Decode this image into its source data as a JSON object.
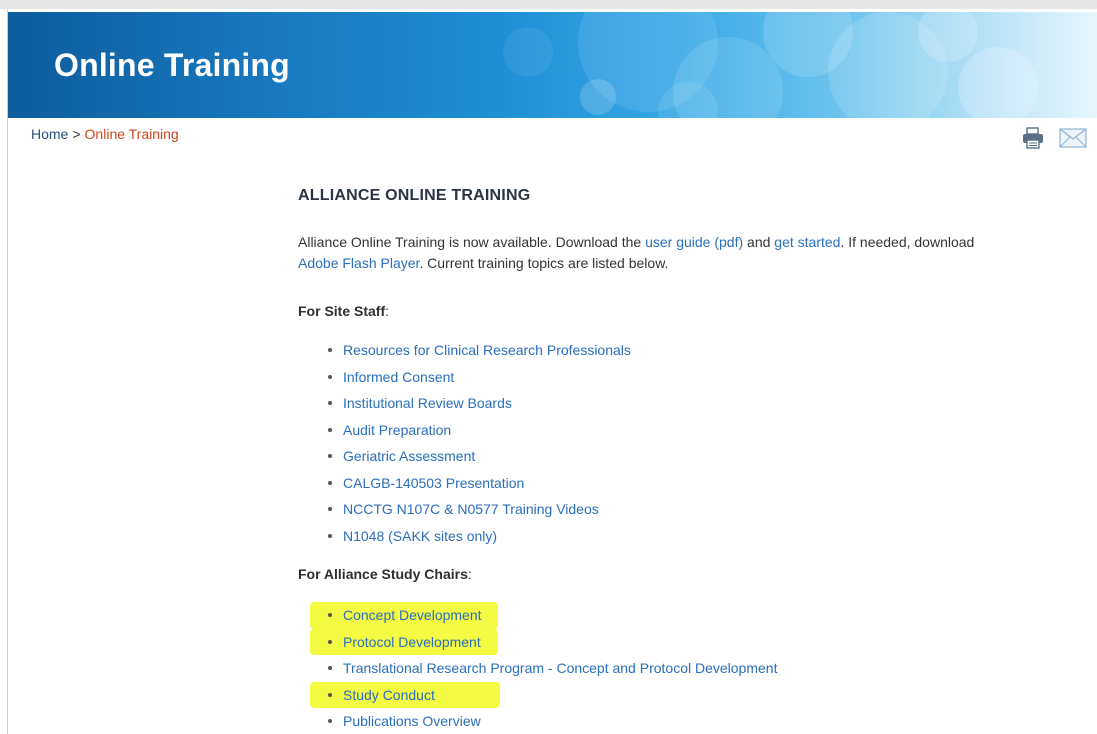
{
  "banner": {
    "title": "Online Training"
  },
  "breadcrumb": {
    "home": "Home",
    "separator": ">",
    "current": "Online Training"
  },
  "tools": {
    "print_icon": "printer-icon",
    "email_icon": "envelope-icon"
  },
  "main": {
    "heading": "ALLIANCE ONLINE TRAINING",
    "intro": {
      "text1": "Alliance Online Training is now available.  Download the ",
      "link_user_guide": "user guide (pdf)",
      "text2": " and ",
      "link_get_started": "get started",
      "text3": ". If needed, download ",
      "link_flash": "Adobe Flash Player",
      "text4": ".  Current training topics are listed below."
    },
    "site_staff": {
      "label": "For Site Staff",
      "colon": ":",
      "items": [
        "Resources for Clinical Research Professionals",
        "Informed Consent",
        "Institutional Review Boards",
        "Audit Preparation",
        "Geriatric Assessment",
        "CALGB-140503 Presentation",
        "NCCTG N107C & N0577 Training Videos",
        "N1048 (SAKK sites only)"
      ]
    },
    "study_chairs": {
      "label": "For Alliance Study Chairs",
      "colon": ":",
      "items": [
        "Concept Development",
        "Protocol Development",
        "Translational Research Program - Concept and Protocol Development",
        "Study Conduct",
        "Publications Overview"
      ]
    }
  },
  "colors": {
    "banner_dark": "#0e5d9c",
    "banner_light": "#e8f6fc",
    "link": "#2a6ebd",
    "breadcrumb_current": "#d0451b",
    "highlight": "#f2fb32"
  }
}
